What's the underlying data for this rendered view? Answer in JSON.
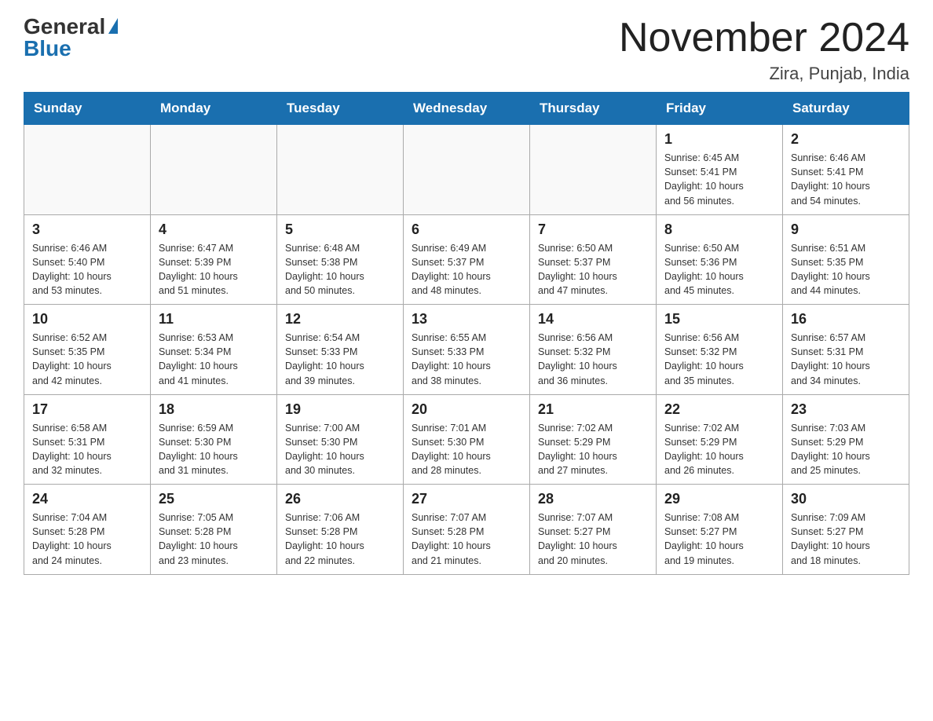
{
  "header": {
    "logo_general": "General",
    "logo_blue": "Blue",
    "month_title": "November 2024",
    "location": "Zira, Punjab, India"
  },
  "weekdays": [
    "Sunday",
    "Monday",
    "Tuesday",
    "Wednesday",
    "Thursday",
    "Friday",
    "Saturday"
  ],
  "weeks": [
    [
      {
        "day": "",
        "info": ""
      },
      {
        "day": "",
        "info": ""
      },
      {
        "day": "",
        "info": ""
      },
      {
        "day": "",
        "info": ""
      },
      {
        "day": "",
        "info": ""
      },
      {
        "day": "1",
        "info": "Sunrise: 6:45 AM\nSunset: 5:41 PM\nDaylight: 10 hours\nand 56 minutes."
      },
      {
        "day": "2",
        "info": "Sunrise: 6:46 AM\nSunset: 5:41 PM\nDaylight: 10 hours\nand 54 minutes."
      }
    ],
    [
      {
        "day": "3",
        "info": "Sunrise: 6:46 AM\nSunset: 5:40 PM\nDaylight: 10 hours\nand 53 minutes."
      },
      {
        "day": "4",
        "info": "Sunrise: 6:47 AM\nSunset: 5:39 PM\nDaylight: 10 hours\nand 51 minutes."
      },
      {
        "day": "5",
        "info": "Sunrise: 6:48 AM\nSunset: 5:38 PM\nDaylight: 10 hours\nand 50 minutes."
      },
      {
        "day": "6",
        "info": "Sunrise: 6:49 AM\nSunset: 5:37 PM\nDaylight: 10 hours\nand 48 minutes."
      },
      {
        "day": "7",
        "info": "Sunrise: 6:50 AM\nSunset: 5:37 PM\nDaylight: 10 hours\nand 47 minutes."
      },
      {
        "day": "8",
        "info": "Sunrise: 6:50 AM\nSunset: 5:36 PM\nDaylight: 10 hours\nand 45 minutes."
      },
      {
        "day": "9",
        "info": "Sunrise: 6:51 AM\nSunset: 5:35 PM\nDaylight: 10 hours\nand 44 minutes."
      }
    ],
    [
      {
        "day": "10",
        "info": "Sunrise: 6:52 AM\nSunset: 5:35 PM\nDaylight: 10 hours\nand 42 minutes."
      },
      {
        "day": "11",
        "info": "Sunrise: 6:53 AM\nSunset: 5:34 PM\nDaylight: 10 hours\nand 41 minutes."
      },
      {
        "day": "12",
        "info": "Sunrise: 6:54 AM\nSunset: 5:33 PM\nDaylight: 10 hours\nand 39 minutes."
      },
      {
        "day": "13",
        "info": "Sunrise: 6:55 AM\nSunset: 5:33 PM\nDaylight: 10 hours\nand 38 minutes."
      },
      {
        "day": "14",
        "info": "Sunrise: 6:56 AM\nSunset: 5:32 PM\nDaylight: 10 hours\nand 36 minutes."
      },
      {
        "day": "15",
        "info": "Sunrise: 6:56 AM\nSunset: 5:32 PM\nDaylight: 10 hours\nand 35 minutes."
      },
      {
        "day": "16",
        "info": "Sunrise: 6:57 AM\nSunset: 5:31 PM\nDaylight: 10 hours\nand 34 minutes."
      }
    ],
    [
      {
        "day": "17",
        "info": "Sunrise: 6:58 AM\nSunset: 5:31 PM\nDaylight: 10 hours\nand 32 minutes."
      },
      {
        "day": "18",
        "info": "Sunrise: 6:59 AM\nSunset: 5:30 PM\nDaylight: 10 hours\nand 31 minutes."
      },
      {
        "day": "19",
        "info": "Sunrise: 7:00 AM\nSunset: 5:30 PM\nDaylight: 10 hours\nand 30 minutes."
      },
      {
        "day": "20",
        "info": "Sunrise: 7:01 AM\nSunset: 5:30 PM\nDaylight: 10 hours\nand 28 minutes."
      },
      {
        "day": "21",
        "info": "Sunrise: 7:02 AM\nSunset: 5:29 PM\nDaylight: 10 hours\nand 27 minutes."
      },
      {
        "day": "22",
        "info": "Sunrise: 7:02 AM\nSunset: 5:29 PM\nDaylight: 10 hours\nand 26 minutes."
      },
      {
        "day": "23",
        "info": "Sunrise: 7:03 AM\nSunset: 5:29 PM\nDaylight: 10 hours\nand 25 minutes."
      }
    ],
    [
      {
        "day": "24",
        "info": "Sunrise: 7:04 AM\nSunset: 5:28 PM\nDaylight: 10 hours\nand 24 minutes."
      },
      {
        "day": "25",
        "info": "Sunrise: 7:05 AM\nSunset: 5:28 PM\nDaylight: 10 hours\nand 23 minutes."
      },
      {
        "day": "26",
        "info": "Sunrise: 7:06 AM\nSunset: 5:28 PM\nDaylight: 10 hours\nand 22 minutes."
      },
      {
        "day": "27",
        "info": "Sunrise: 7:07 AM\nSunset: 5:28 PM\nDaylight: 10 hours\nand 21 minutes."
      },
      {
        "day": "28",
        "info": "Sunrise: 7:07 AM\nSunset: 5:27 PM\nDaylight: 10 hours\nand 20 minutes."
      },
      {
        "day": "29",
        "info": "Sunrise: 7:08 AM\nSunset: 5:27 PM\nDaylight: 10 hours\nand 19 minutes."
      },
      {
        "day": "30",
        "info": "Sunrise: 7:09 AM\nSunset: 5:27 PM\nDaylight: 10 hours\nand 18 minutes."
      }
    ]
  ]
}
